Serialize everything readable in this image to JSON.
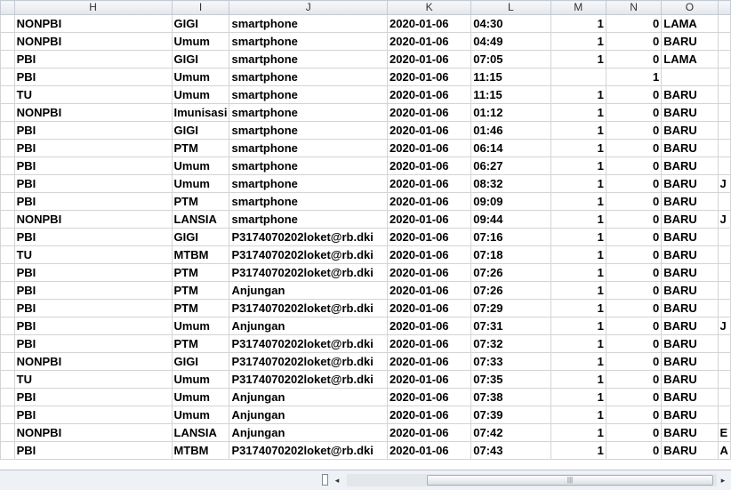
{
  "columns": [
    "H",
    "I",
    "J",
    "K",
    "L",
    "M",
    "N",
    "O"
  ],
  "rows": [
    [
      "NONPBI",
      "GIGI",
      "smartphone",
      "2020-01-06",
      "04:30",
      "1",
      "0",
      "LAMA",
      ""
    ],
    [
      "NONPBI",
      "Umum",
      "smartphone",
      "2020-01-06",
      "04:49",
      "1",
      "0",
      "BARU",
      ""
    ],
    [
      "PBI",
      "GIGI",
      "smartphone",
      "2020-01-06",
      "07:05",
      "1",
      "0",
      "LAMA",
      ""
    ],
    [
      "PBI",
      "Umum",
      "smartphone",
      "2020-01-06",
      "11:15",
      "",
      "1",
      "",
      ""
    ],
    [
      "TU",
      "Umum",
      "smartphone",
      "2020-01-06",
      "11:15",
      "1",
      "0",
      "BARU",
      ""
    ],
    [
      "NONPBI",
      "Imunisasi",
      "smartphone",
      "2020-01-06",
      "01:12",
      "1",
      "0",
      "BARU",
      ""
    ],
    [
      "PBI",
      "GIGI",
      "smartphone",
      "2020-01-06",
      "01:46",
      "1",
      "0",
      "BARU",
      ""
    ],
    [
      "PBI",
      "PTM",
      "smartphone",
      "2020-01-06",
      "06:14",
      "1",
      "0",
      "BARU",
      ""
    ],
    [
      "PBI",
      "Umum",
      "smartphone",
      "2020-01-06",
      "06:27",
      "1",
      "0",
      "BARU",
      ""
    ],
    [
      "PBI",
      "Umum",
      "smartphone",
      "2020-01-06",
      "08:32",
      "1",
      "0",
      "BARU",
      "J"
    ],
    [
      "PBI",
      "PTM",
      "smartphone",
      "2020-01-06",
      "09:09",
      "1",
      "0",
      "BARU",
      ""
    ],
    [
      "NONPBI",
      "LANSIA",
      "smartphone",
      "2020-01-06",
      "09:44",
      "1",
      "0",
      "BARU",
      "J"
    ],
    [
      "PBI",
      "GIGI",
      "P3174070202loket@rb.dki",
      "2020-01-06",
      "07:16",
      "1",
      "0",
      "BARU",
      ""
    ],
    [
      "TU",
      "MTBM",
      "P3174070202loket@rb.dki",
      "2020-01-06",
      "07:18",
      "1",
      "0",
      "BARU",
      ""
    ],
    [
      "PBI",
      "PTM",
      "P3174070202loket@rb.dki",
      "2020-01-06",
      "07:26",
      "1",
      "0",
      "BARU",
      ""
    ],
    [
      "PBI",
      "PTM",
      "Anjungan",
      "2020-01-06",
      "07:26",
      "1",
      "0",
      "BARU",
      ""
    ],
    [
      "PBI",
      "PTM",
      "P3174070202loket@rb.dki",
      "2020-01-06",
      "07:29",
      "1",
      "0",
      "BARU",
      ""
    ],
    [
      "PBI",
      "Umum",
      "Anjungan",
      "2020-01-06",
      "07:31",
      "1",
      "0",
      "BARU",
      "J"
    ],
    [
      "PBI",
      "PTM",
      "P3174070202loket@rb.dki",
      "2020-01-06",
      "07:32",
      "1",
      "0",
      "BARU",
      ""
    ],
    [
      "NONPBI",
      "GIGI",
      "P3174070202loket@rb.dki",
      "2020-01-06",
      "07:33",
      "1",
      "0",
      "BARU",
      ""
    ],
    [
      "TU",
      "Umum",
      "P3174070202loket@rb.dki",
      "2020-01-06",
      "07:35",
      "1",
      "0",
      "BARU",
      ""
    ],
    [
      "PBI",
      "Umum",
      "Anjungan",
      "2020-01-06",
      "07:38",
      "1",
      "0",
      "BARU",
      ""
    ],
    [
      "PBI",
      "Umum",
      "Anjungan",
      "2020-01-06",
      "07:39",
      "1",
      "0",
      "BARU",
      ""
    ],
    [
      "NONPBI",
      "LANSIA",
      "Anjungan",
      "2020-01-06",
      "07:42",
      "1",
      "0",
      "BARU",
      "E"
    ],
    [
      "PBI",
      "MTBM",
      "P3174070202loket@rb.dki",
      "2020-01-06",
      "07:43",
      "1",
      "0",
      "BARU",
      "A"
    ]
  ],
  "scrollbar": {
    "left_arrow": "◂",
    "right_arrow": "▸",
    "grip": "|||"
  }
}
